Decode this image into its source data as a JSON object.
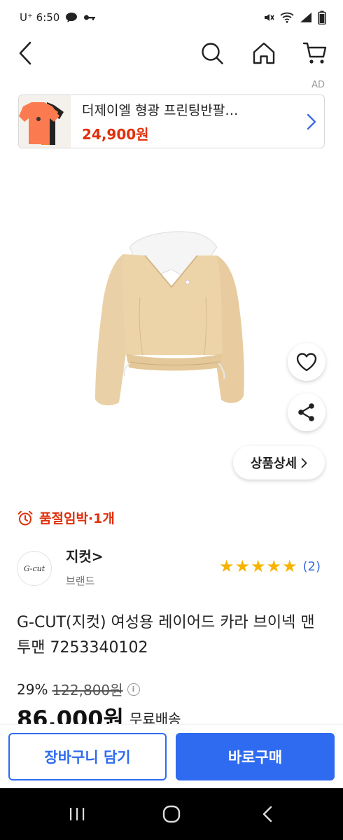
{
  "status_bar": {
    "carrier_time": "U⁺ 6:50",
    "icons": [
      "chat-bubble-icon",
      "key-icon",
      "mute-icon",
      "wifi-icon",
      "signal-icon",
      "battery-icon"
    ]
  },
  "top_nav": {
    "icons": [
      "back-arrow-icon",
      "search-icon",
      "home-icon",
      "cart-icon"
    ]
  },
  "ad": {
    "label": "AD",
    "title": "더제이엘 형광 프린팅반팔…",
    "price": "24,900원"
  },
  "product": {
    "detail_button": "상품상세",
    "stock_alert": "품절임박·1개",
    "brand": {
      "logo_text": "G-cut",
      "name": "지컷>",
      "sub": "브랜드"
    },
    "rating": {
      "stars": 5,
      "count": "(2)"
    },
    "title": "G-CUT(지컷) 여성용 레이어드 카라 브이넥 맨투맨 7253340102",
    "discount": "29%",
    "original_price": "122,800원",
    "sale_price": "86,000원",
    "shipping": "무료배송"
  },
  "actions": {
    "add_to_cart": "장바구니 담기",
    "buy_now": "바로구매"
  },
  "colors": {
    "accent_blue": "#2f6bf0",
    "alert_red": "#e0300b",
    "star_gold": "#f6b400",
    "sweater_beige": "#ead0a6"
  }
}
